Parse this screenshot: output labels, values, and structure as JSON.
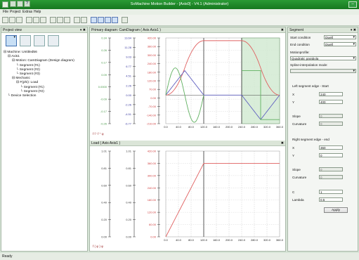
{
  "window": {
    "title": "SoMachine Motion Builder - [Axis0] - V4.1 (Administrator)"
  },
  "menu": {
    "items": [
      "File",
      "Project",
      "Extras",
      "Help"
    ]
  },
  "project_view": {
    "title": "Project view",
    "tree": [
      {
        "label": "Machine: Untitled56",
        "level": 0,
        "toggle": "⊟"
      },
      {
        "label": "Axis1",
        "level": 1,
        "toggle": "⊟"
      },
      {
        "label": "Motion: CamDiagram (Design diagram)",
        "level": 2,
        "toggle": "⊟"
      },
      {
        "label": "Segment (#1)",
        "level": 3,
        "toggle": ""
      },
      {
        "label": "Segment (#2)",
        "level": 3,
        "toggle": ""
      },
      {
        "label": "Segment (#3)",
        "level": 3,
        "toggle": ""
      },
      {
        "label": "Mechanic",
        "level": 2,
        "toggle": "⊟"
      },
      {
        "label": "F(phi): Load",
        "level": 3,
        "toggle": "⊟"
      },
      {
        "label": "Segment (#1)",
        "level": 4,
        "toggle": ""
      },
      {
        "label": "Segment (#2)",
        "level": 4,
        "toggle": ""
      },
      {
        "label": "Device Selection",
        "level": 1,
        "toggle": ""
      }
    ]
  },
  "primary_diagram": {
    "title": "Primary diagram: CamDiagram ( Axis Axis1 )",
    "legend": "f  f '  f ''  φ",
    "axis1": [
      "0.34",
      "0.26",
      "0.17",
      "0.09",
      "0.0000",
      "-0.09",
      "-0.17",
      "-0.26"
    ],
    "axis2": [
      "13.64",
      "11.28",
      "9.03",
      "6.77",
      "4.51",
      "2.26",
      "0.00",
      "-2.26",
      "-4.51",
      "-6.77"
    ],
    "axis3": [
      "420.00",
      "360.00",
      "300.00",
      "240.00",
      "180.00",
      "120.00",
      "70.00",
      "0.00",
      "-70.00",
      "-140.00",
      "-210.00"
    ],
    "axis1_colored": "#4a9a4a",
    "axis2_colored": "#3a3aa0",
    "axis3_colored": "#d04040"
  },
  "load_diagram": {
    "title": "Load ( Axis Axis1 )",
    "legend": "f ( φ )  φ",
    "axis1": [
      "1.01",
      "0.81",
      "0.60",
      "0.40",
      "0.20",
      "0.00"
    ],
    "axis2": [
      "1.01",
      "0.81",
      "0.60",
      "0.40",
      "0.20",
      "0.00"
    ],
    "axis3": [
      "420.00",
      "360.00",
      "300.00",
      "240.00",
      "180.00",
      "120.00",
      "60.00",
      "0.00"
    ]
  },
  "x_ticks": [
    "0.0",
    "40.0",
    "80.0",
    "120.0",
    "160.0",
    "200.0",
    "240.0",
    "280.0",
    "320.0",
    "360.0"
  ],
  "segment_panel": {
    "title": "Segment",
    "start_condition_label": "Start condition",
    "start_condition_value": "Dwell",
    "end_condition_label": "End condition",
    "end_condition_value": "Dwell",
    "motionprofile_label": "Motionprofile:",
    "motionprofile_value": "Quadratic parabola",
    "spline_label": "Spline-interpolation mode:",
    "left_edge_label": "Left segment edge - Start",
    "x_label": "X",
    "left_x": "240",
    "y_label": "Y",
    "left_y": "400",
    "slope_label": "Slope",
    "left_slope": "0",
    "curvature_label": "Curvature",
    "left_curvature": "0",
    "right_edge_label": "Right segment edge - end",
    "right_x": "360",
    "right_y": "0",
    "right_slope": "0",
    "right_curvature": "0",
    "c_label": "C",
    "c_value": "1",
    "lambda_label": "Lambda",
    "lambda_value": "0.5",
    "apply_label": "Apply"
  },
  "statusbar": {
    "text": "Ready"
  }
}
